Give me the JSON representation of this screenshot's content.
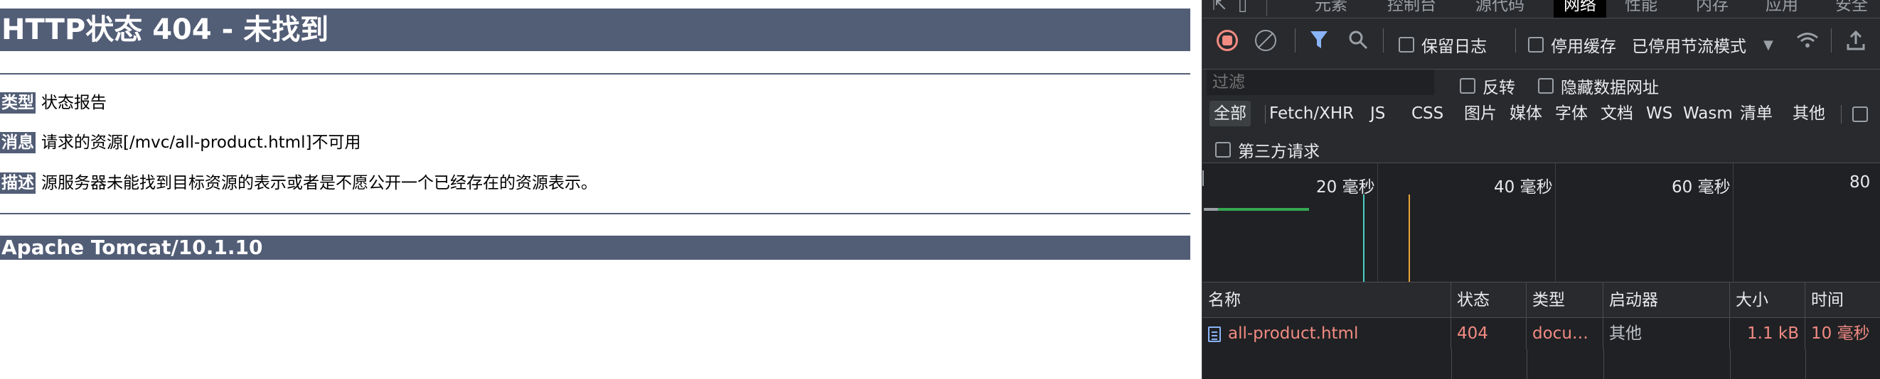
{
  "page": {
    "title": "HTTP状态 404 - 未找到",
    "rows": [
      {
        "label": "类型",
        "value": "状态报告"
      },
      {
        "label": "消息",
        "value": "请求的资源[/mvc/all-product.html]不可用"
      },
      {
        "label": "描述",
        "value": "源服务器未能找到目标资源的表示或者是不愿公开一个已经存在的资源表示。"
      }
    ],
    "server": "Apache Tomcat/10.1.10"
  },
  "devtools": {
    "tabs": [
      "元素",
      "控制台",
      "源代码",
      "网络",
      "性能",
      "内存",
      "应用",
      "安全"
    ],
    "active_tab": "网络",
    "toolbar": {
      "preserve_log": "保留日志",
      "disable_cache": "停用缓存",
      "throttling": "已停用节流模式"
    },
    "filter": {
      "placeholder": "过滤",
      "invert": "反转",
      "hide_data_urls": "隐藏数据网址",
      "types": [
        "全部",
        "Fetch/XHR",
        "JS",
        "CSS",
        "图片",
        "媒体",
        "字体",
        "文档",
        "WS",
        "Wasm",
        "清单",
        "其他"
      ],
      "third_party": "第三方请求"
    },
    "overview": {
      "ticks": [
        "20 毫秒",
        "40 毫秒",
        "60 毫秒",
        "80"
      ]
    },
    "table": {
      "columns": [
        "名称",
        "状态",
        "类型",
        "启动器",
        "大小",
        "时间"
      ],
      "rows": [
        {
          "name": "all-product.html",
          "status": "404",
          "type": "docu…",
          "initiator": "其他",
          "size": "1.1 kB",
          "time": "10 毫秒"
        }
      ]
    },
    "colors": {
      "error_red": "#f28b82",
      "accent_blue": "#8ab4f8",
      "bg": "#202124"
    }
  }
}
